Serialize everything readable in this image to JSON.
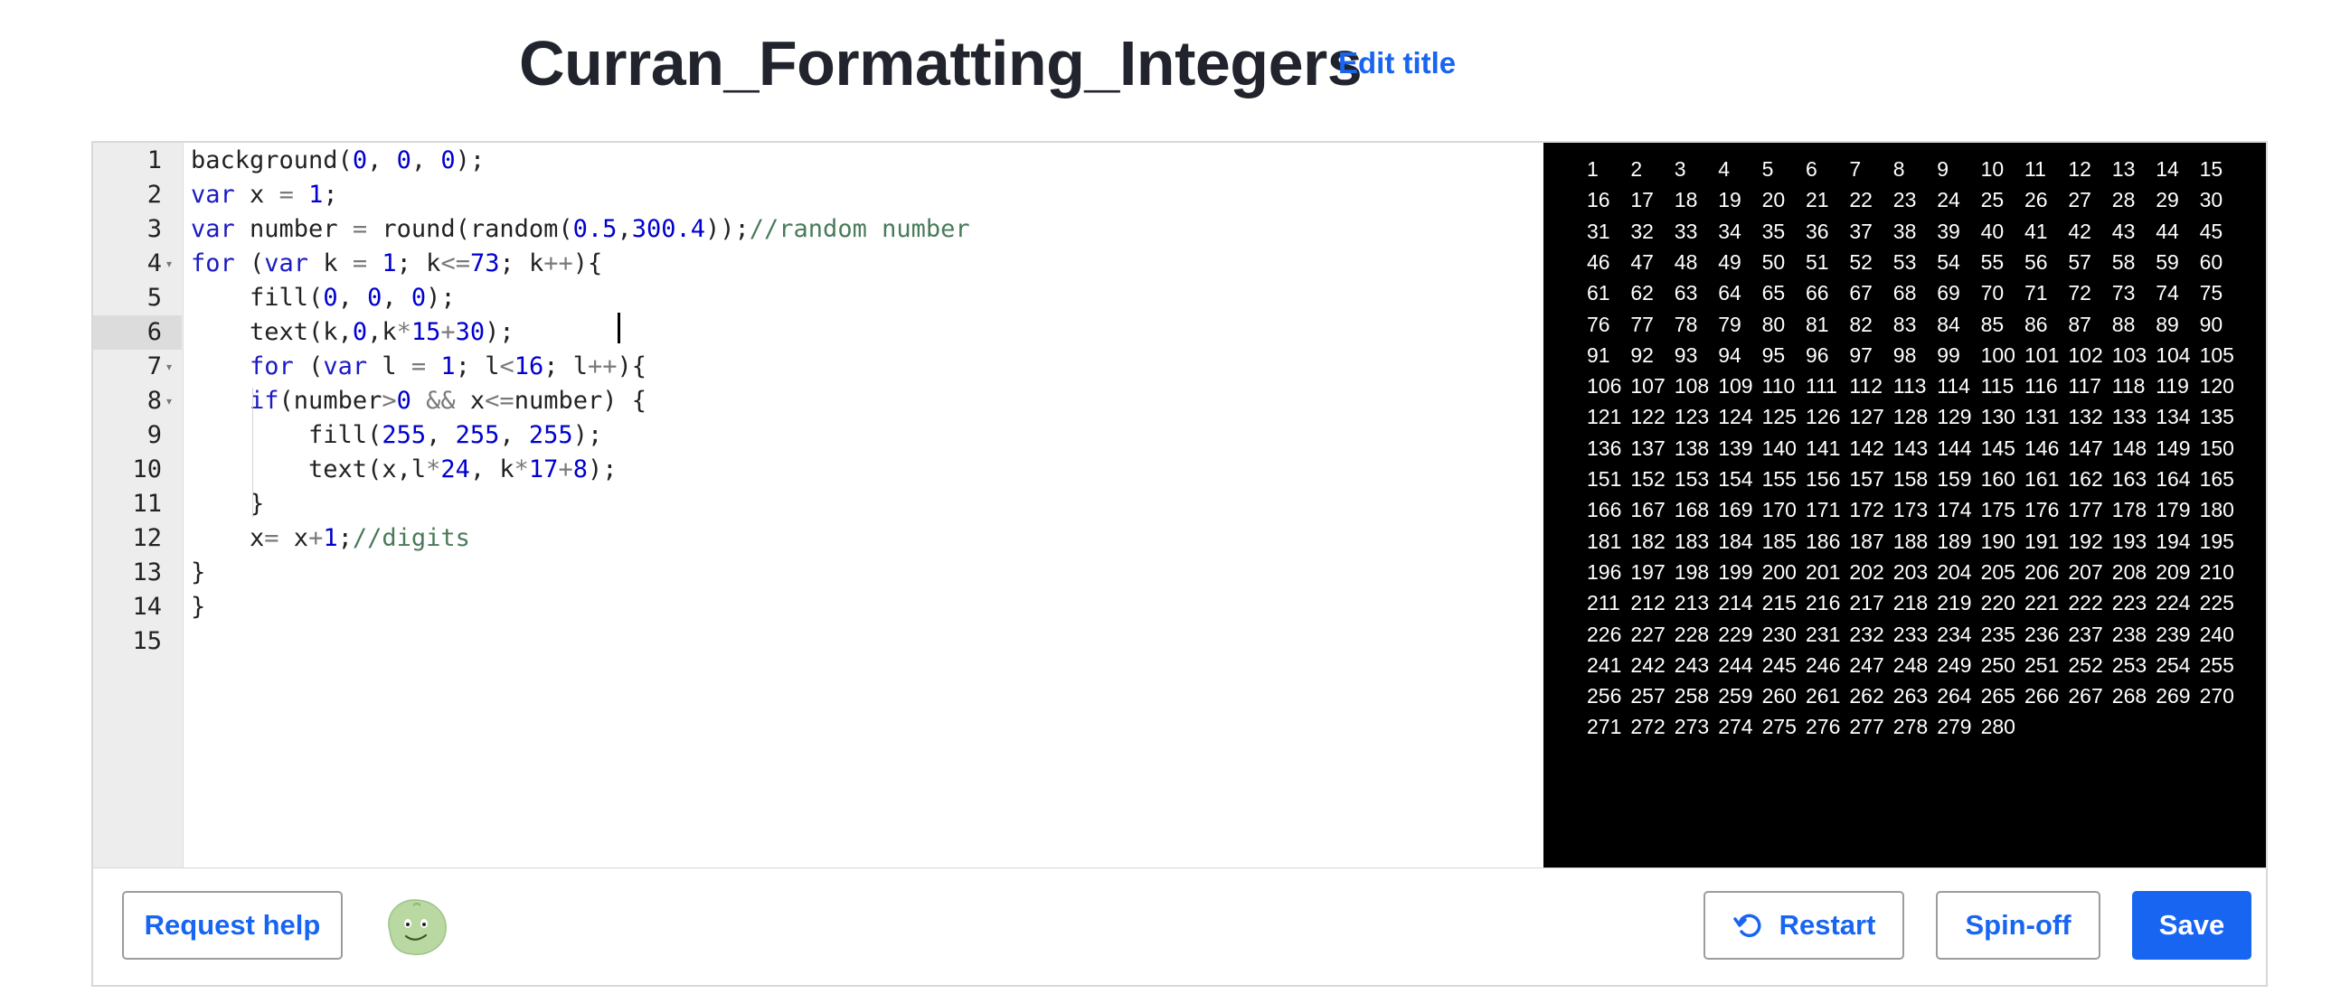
{
  "header": {
    "title": "Curran_Formatting_Integers",
    "edit_title_label": "Edit title"
  },
  "editor": {
    "line_numbers": [
      "1",
      "2",
      "3",
      "4",
      "5",
      "6",
      "7",
      "8",
      "9",
      "10",
      "11",
      "12",
      "13",
      "14",
      "15"
    ],
    "active_line": 6,
    "lines": [
      [
        [
          "background(",
          "t"
        ],
        [
          "0",
          "n"
        ],
        [
          ", ",
          "t"
        ],
        [
          "0",
          "n"
        ],
        [
          ", ",
          "t"
        ],
        [
          "0",
          "n"
        ],
        [
          ");",
          "t"
        ]
      ],
      [
        [
          "var",
          "k"
        ],
        [
          " x ",
          "t"
        ],
        [
          "=",
          "o"
        ],
        [
          " ",
          "t"
        ],
        [
          "1",
          "n"
        ],
        [
          ";",
          "t"
        ]
      ],
      [
        [
          "var",
          "k"
        ],
        [
          " number ",
          "t"
        ],
        [
          "=",
          "o"
        ],
        [
          " round(random(",
          "t"
        ],
        [
          "0.5",
          "n"
        ],
        [
          ",",
          "t"
        ],
        [
          "300.4",
          "n"
        ],
        [
          "));",
          "t"
        ],
        [
          "//random number",
          "c"
        ]
      ],
      [
        [
          "for",
          "k"
        ],
        [
          " (",
          "t"
        ],
        [
          "var",
          "k"
        ],
        [
          " k ",
          "t"
        ],
        [
          "=",
          "o"
        ],
        [
          " ",
          "t"
        ],
        [
          "1",
          "n"
        ],
        [
          "; k",
          "t"
        ],
        [
          "<=",
          "o"
        ],
        [
          "73",
          "n"
        ],
        [
          "; k",
          "t"
        ],
        [
          "++",
          "o"
        ],
        [
          "){",
          "t"
        ]
      ],
      [
        [
          "    fill(",
          "t"
        ],
        [
          "0",
          "n"
        ],
        [
          ", ",
          "t"
        ],
        [
          "0",
          "n"
        ],
        [
          ", ",
          "t"
        ],
        [
          "0",
          "n"
        ],
        [
          ");",
          "t"
        ]
      ],
      [
        [
          "    text(k,",
          "t"
        ],
        [
          "0",
          "n"
        ],
        [
          ",k",
          "t"
        ],
        [
          "*",
          "o"
        ],
        [
          "15",
          "n"
        ],
        [
          "+",
          "o"
        ],
        [
          "30",
          "n"
        ],
        [
          ");",
          "t"
        ]
      ],
      [
        [
          "    ",
          "t"
        ],
        [
          "for",
          "k"
        ],
        [
          " (",
          "t"
        ],
        [
          "var",
          "k"
        ],
        [
          " l ",
          "t"
        ],
        [
          "=",
          "o"
        ],
        [
          " ",
          "t"
        ],
        [
          "1",
          "n"
        ],
        [
          "; l",
          "t"
        ],
        [
          "<",
          "o"
        ],
        [
          "16",
          "n"
        ],
        [
          "; l",
          "t"
        ],
        [
          "++",
          "o"
        ],
        [
          "){",
          "t"
        ]
      ],
      [
        [
          "    ",
          "t"
        ],
        [
          "if",
          "k"
        ],
        [
          "(number",
          "t"
        ],
        [
          ">",
          "o"
        ],
        [
          "0",
          "n"
        ],
        [
          " ",
          "t"
        ],
        [
          "&&",
          "o"
        ],
        [
          " x",
          "t"
        ],
        [
          "<=",
          "o"
        ],
        [
          "number) {",
          "t"
        ]
      ],
      [
        [
          "        fill(",
          "t"
        ],
        [
          "255",
          "n"
        ],
        [
          ", ",
          "t"
        ],
        [
          "255",
          "n"
        ],
        [
          ", ",
          "t"
        ],
        [
          "255",
          "n"
        ],
        [
          ");",
          "t"
        ]
      ],
      [
        [
          "        text(x,l",
          "t"
        ],
        [
          "*",
          "o"
        ],
        [
          "24",
          "n"
        ],
        [
          ", k",
          "t"
        ],
        [
          "*",
          "o"
        ],
        [
          "17",
          "n"
        ],
        [
          "+",
          "o"
        ],
        [
          "8",
          "n"
        ],
        [
          ");",
          "t"
        ]
      ],
      [
        [
          "    }",
          "t"
        ]
      ],
      [
        [
          "    x",
          "t"
        ],
        [
          "=",
          "o"
        ],
        [
          " x",
          "t"
        ],
        [
          "+",
          "o"
        ],
        [
          "1",
          "n"
        ],
        [
          ";",
          "t"
        ],
        [
          "//digits",
          "c"
        ]
      ],
      [
        [
          "}",
          "t"
        ]
      ],
      [
        [
          "}",
          "t"
        ]
      ],
      [
        [
          "",
          "t"
        ]
      ]
    ],
    "colors": {
      "keyword": "#1a1ac4",
      "number": "#0000cf",
      "operator": "#7a7a7a",
      "comment": "#4a7a5a"
    }
  },
  "canvas": {
    "background": "#000000",
    "text_color": "#ffffff",
    "columns": 15,
    "last_number": 280
  },
  "toolbar": {
    "request_help_label": "Request help",
    "avatar_icon": "green-blob-avatar-icon",
    "restart_label": "Restart",
    "restart_icon": "restart-icon",
    "spinoff_label": "Spin-off",
    "save_label": "Save",
    "accent_color": "#1865f2"
  }
}
